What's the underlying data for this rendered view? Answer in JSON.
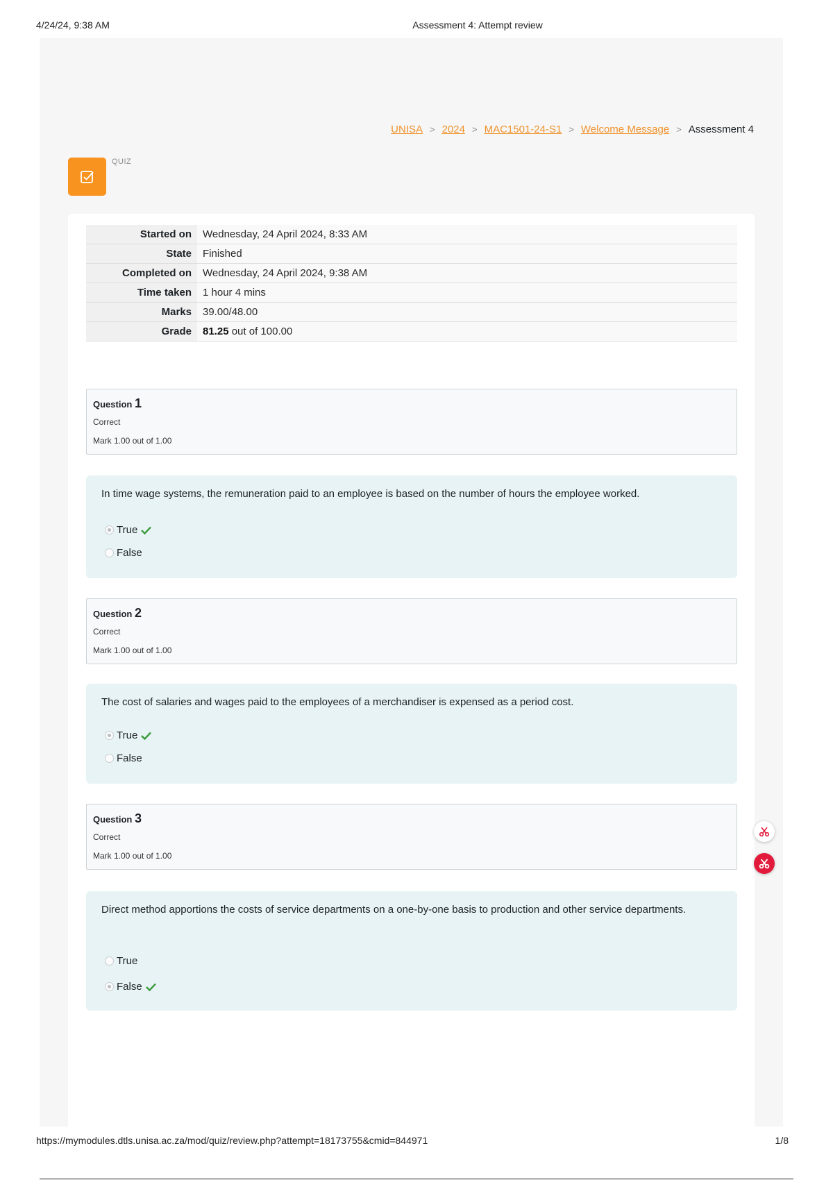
{
  "print": {
    "date": "4/24/24, 9:38 AM",
    "title": "Assessment 4: Attempt review",
    "url": "https://mymodules.dtls.unisa.ac.za/mod/quiz/review.php?attempt=18173755&cmid=844971",
    "page": "1/8"
  },
  "breadcrumb": {
    "links": [
      "UNISA",
      "2024",
      "MAC1501-24-S1",
      "Welcome Message"
    ],
    "current": "Assessment 4"
  },
  "quiz": {
    "label": "QUIZ",
    "icon": "quiz-checkbox-icon",
    "accent": "#f7931e"
  },
  "summary": [
    {
      "label": "Started on",
      "value": "Wednesday, 24 April 2024, 8:33 AM"
    },
    {
      "label": "State",
      "value": "Finished"
    },
    {
      "label": "Completed on",
      "value": "Wednesday, 24 April 2024, 9:38 AM"
    },
    {
      "label": "Time taken",
      "value": "1 hour 4 mins"
    },
    {
      "label": "Marks",
      "value": "39.00/48.00"
    },
    {
      "label": "Grade",
      "grade_value": "81.25",
      "grade_suffix": " out of 100.00"
    }
  ],
  "questions": [
    {
      "label": "Question",
      "number": "1",
      "state": "Correct",
      "mark": "Mark 1.00 out of 1.00",
      "prompt": "In time wage systems, the remuneration paid to an employee is based on the number of hours the employee worked.",
      "options": [
        {
          "label": "True",
          "selected": true,
          "correct": true
        },
        {
          "label": "False",
          "selected": false,
          "correct": false
        }
      ]
    },
    {
      "label": "Question",
      "number": "2",
      "state": "Correct",
      "mark": "Mark 1.00 out of 1.00",
      "prompt": "The cost of salaries and wages paid to the employees of a merchandiser is expensed as a period cost.",
      "options": [
        {
          "label": "True",
          "selected": true,
          "correct": true
        },
        {
          "label": "False",
          "selected": false,
          "correct": false
        }
      ]
    },
    {
      "label": "Question",
      "number": "3",
      "state": "Correct",
      "mark": "Mark 1.00 out of 1.00",
      "prompt": "Direct method apportions the costs of service departments on a one-by-one basis to production and other service departments.",
      "options": [
        {
          "label": "True",
          "selected": false,
          "correct": false
        },
        {
          "label": "False",
          "selected": true,
          "correct": true
        }
      ]
    }
  ],
  "colors": {
    "link": "#f0922b",
    "question_bg": "#e7f3f5",
    "tick": "#3c9a3c",
    "side_button": "#e21b3c"
  }
}
